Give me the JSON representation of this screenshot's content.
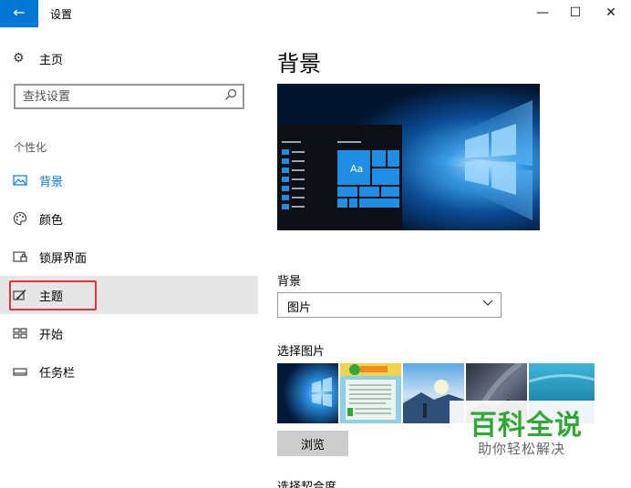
{
  "window": {
    "title": "设置",
    "back_glyph": "←",
    "minimize_glyph": "—",
    "maximize_glyph": "☐",
    "close_glyph": "✕",
    "accent": "#0078d7"
  },
  "sidebar": {
    "home_label": "主页",
    "search_placeholder": "查找设置",
    "section_heading": "个性化",
    "items": [
      {
        "label": "背景",
        "icon": "picture-icon",
        "active": true
      },
      {
        "label": "颜色",
        "icon": "palette-icon"
      },
      {
        "label": "锁屏界面",
        "icon": "lock-screen-icon"
      },
      {
        "label": "主题",
        "icon": "theme-brush-icon",
        "highlighted": true
      },
      {
        "label": "开始",
        "icon": "start-tiles-icon"
      },
      {
        "label": "任务栏",
        "icon": "taskbar-icon"
      }
    ]
  },
  "main": {
    "title": "背景",
    "preview_tile_text": "Aa",
    "background_label": "背景",
    "background_value": "图片",
    "choose_picture_label": "选择图片",
    "browse_label": "浏览",
    "fit_label": "选择契合度"
  },
  "watermark": {
    "main": "百科全说",
    "sub": "助你轻松解决",
    "color": "#2fa836"
  }
}
